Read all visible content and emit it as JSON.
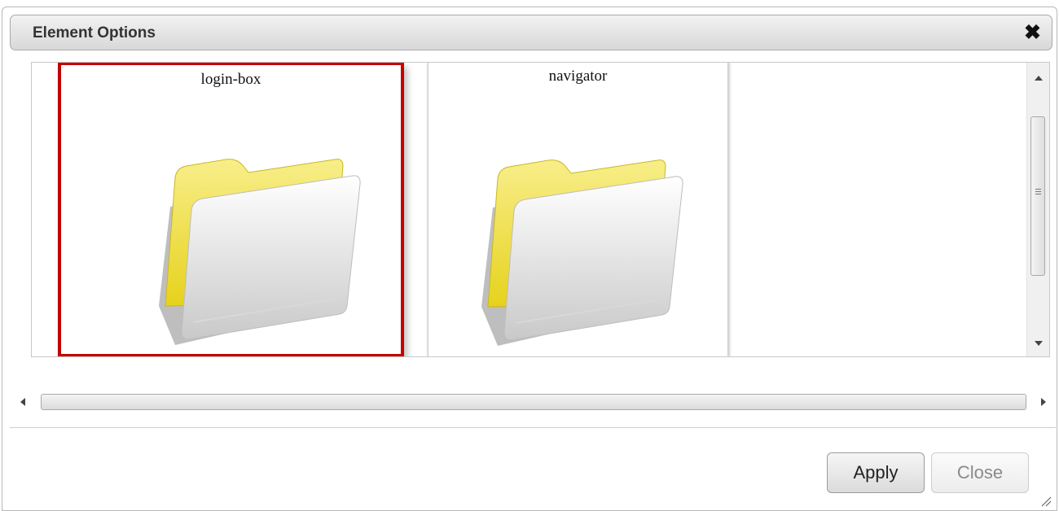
{
  "dialog": {
    "title": "Element Options",
    "close_icon": "close-icon"
  },
  "items": [
    {
      "label": "login-box",
      "icon": "folder-icon",
      "selected": true
    },
    {
      "label": "navigator",
      "icon": "folder-icon",
      "selected": false
    }
  ],
  "buttons": {
    "apply_label": "Apply",
    "close_label": "Close"
  },
  "colors": {
    "selection": "#c40000",
    "folder_yellow": "#f2e24a"
  }
}
